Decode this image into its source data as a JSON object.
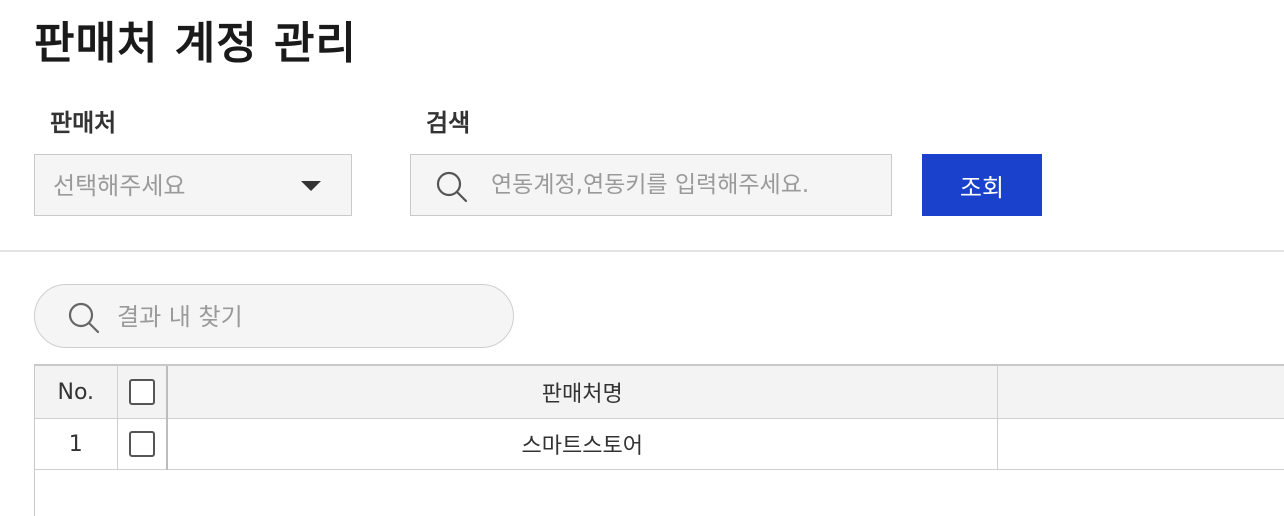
{
  "page": {
    "title": "판매처 계정 관리"
  },
  "filters": {
    "seller_label": "판매처",
    "seller_select_value": "선택해주세요",
    "search_label": "검색",
    "search_placeholder": "연동계정,연동키를 입력해주세요.",
    "search_value": "",
    "query_button_label": "조회"
  },
  "results": {
    "search_placeholder": "결과 내 찾기",
    "search_value": "",
    "columns": [
      "No.",
      "",
      "판매처명",
      ""
    ],
    "rows": [
      {
        "no": "1",
        "checked": false,
        "seller_name": "스마트스토어",
        "extra": ""
      }
    ]
  },
  "colors": {
    "primary_button": "#1941cc",
    "input_background": "#f5f5f5",
    "header_background": "#f3f3f3"
  },
  "icons": {
    "search": "search-icon",
    "dropdown": "caret-down-icon",
    "checkbox": "checkbox-icon"
  }
}
